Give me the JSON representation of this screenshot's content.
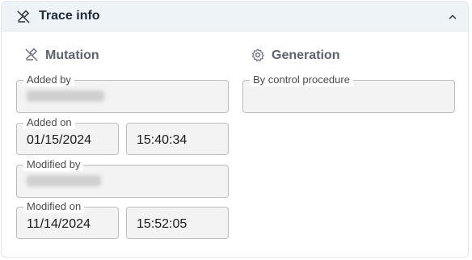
{
  "header": {
    "title": "Trace info",
    "chevron": "chevron-up-icon",
    "icon": "edit-off-icon"
  },
  "mutation": {
    "title": "Mutation",
    "icon": "edit-off-icon",
    "added_by": {
      "label": "Added by",
      "value": ""
    },
    "added_on": {
      "label": "Added on",
      "date": "01/15/2024",
      "time": "15:40:34"
    },
    "modified_by": {
      "label": "Modified by",
      "value": ""
    },
    "modified_on": {
      "label": "Modified on",
      "date": "11/14/2024",
      "time": "15:52:05"
    }
  },
  "generation": {
    "title": "Generation",
    "icon": "gear-icon",
    "by_control_procedure": {
      "label": "By control procedure",
      "value": ""
    }
  }
}
